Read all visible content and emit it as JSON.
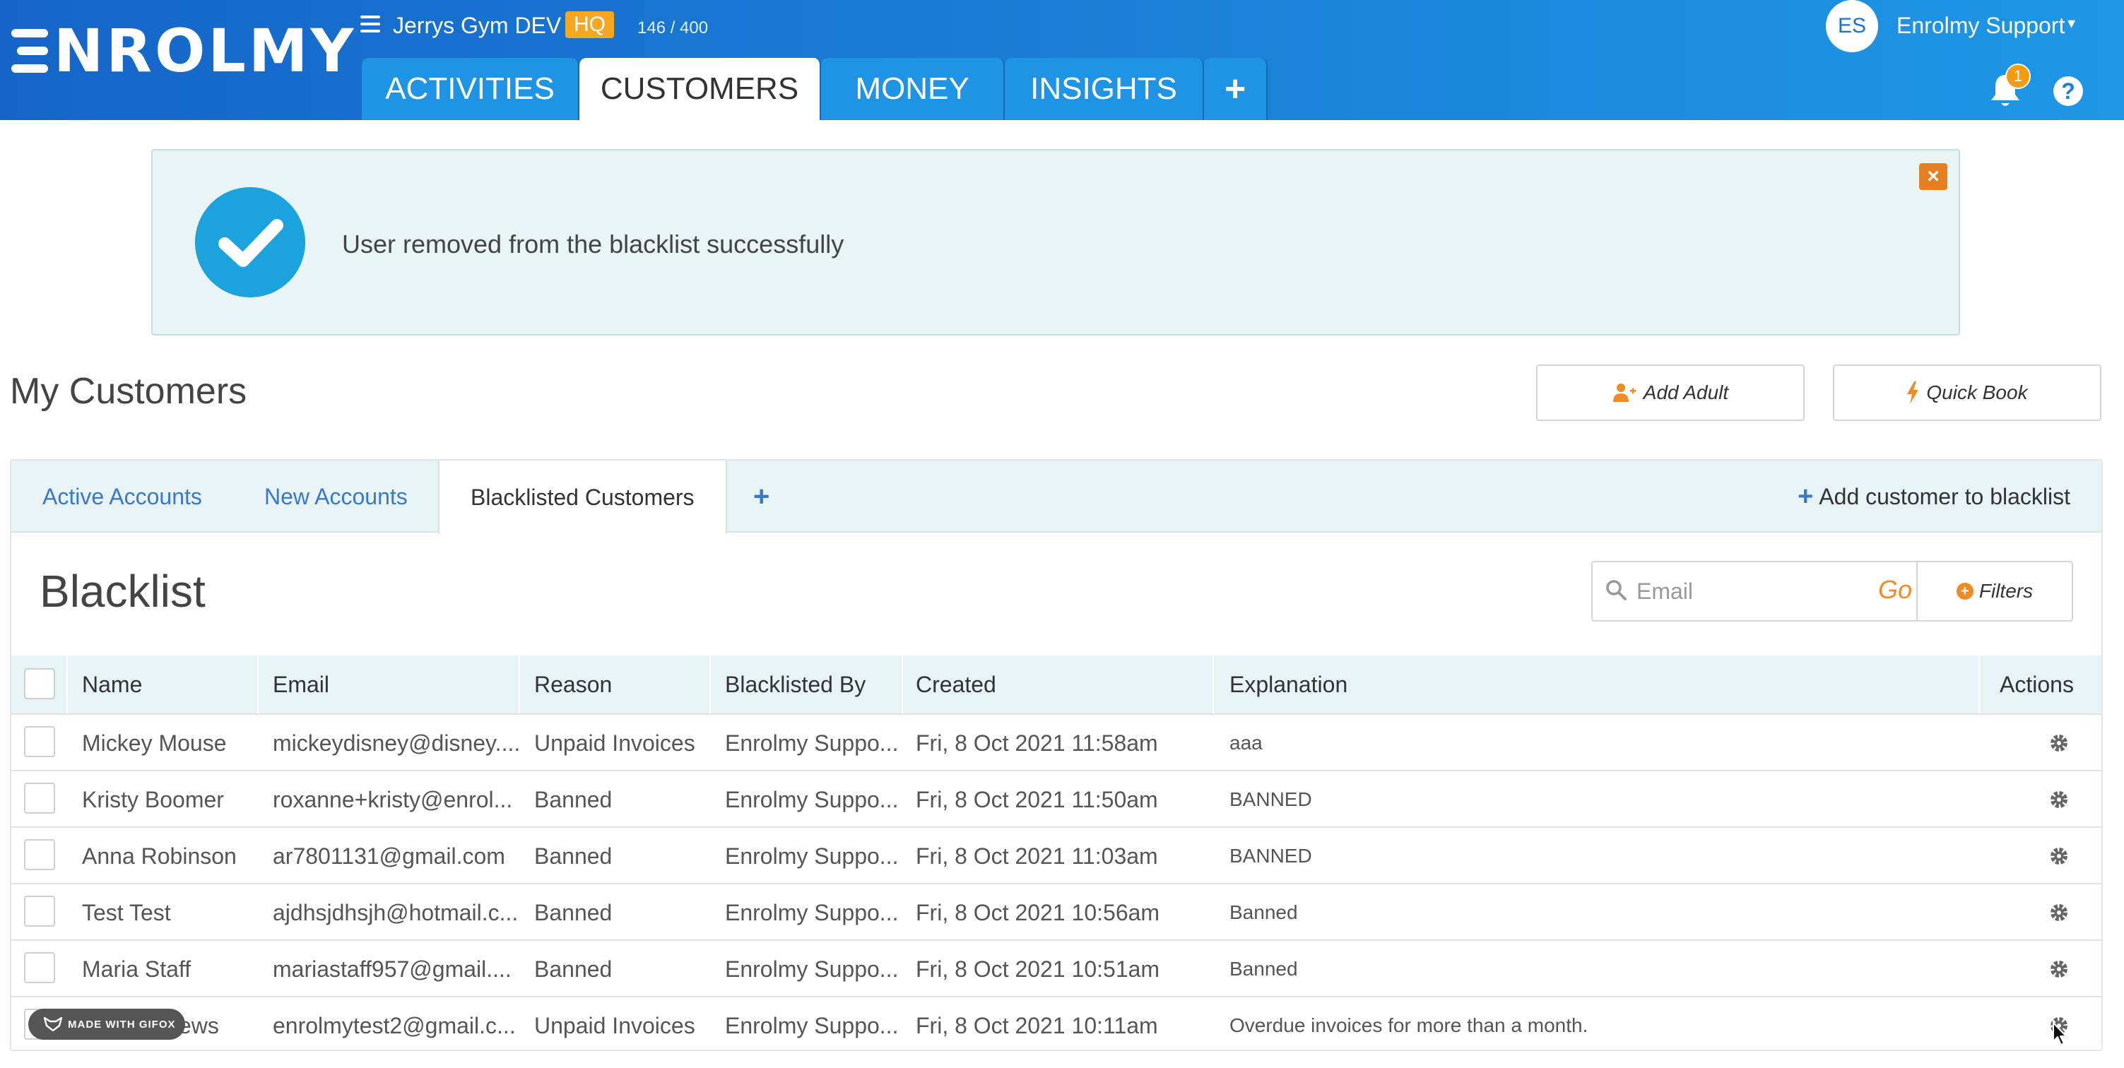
{
  "header": {
    "logo_text": "NROLMY",
    "org_name": "Jerrys Gym DEV",
    "hq_badge": "HQ",
    "counter": "146 / 400",
    "main_tabs": [
      "ACTIVITIES",
      "CUSTOMERS",
      "MONEY",
      "INSIGHTS"
    ],
    "active_tab": "CUSTOMERS",
    "avatar_initials": "ES",
    "user_name": "Enrolmy Support",
    "notification_count": "1",
    "help_label": "?"
  },
  "alert": {
    "message": "User removed from the blacklist successfully",
    "close_label": "×"
  },
  "page": {
    "title": "My Customers",
    "add_adult_label": "Add Adult",
    "quick_book_label": "Quick Book"
  },
  "sub_tabs": {
    "items": [
      "Active Accounts",
      "New Accounts",
      "Blacklisted Customers"
    ],
    "active": "Blacklisted Customers",
    "plus": "+",
    "add_to_blacklist": "Add customer to blacklist"
  },
  "blacklist": {
    "title": "Blacklist",
    "search_placeholder": "Email",
    "go_label": "Go",
    "filters_label": "Filters",
    "columns": [
      "Name",
      "Email",
      "Reason",
      "Blacklisted By",
      "Created",
      "Explanation",
      "Actions"
    ],
    "rows": [
      {
        "name": "Mickey Mouse",
        "email": "mickeydisney@disney....",
        "reason": "Unpaid Invoices",
        "by": "Enrolmy Suppo...",
        "created": "Fri, 8 Oct 2021 11:58am",
        "explanation": "aaa"
      },
      {
        "name": "Kristy Boomer",
        "email": "roxanne+kristy@enrol...",
        "reason": "Banned",
        "by": "Enrolmy Suppo...",
        "created": "Fri, 8 Oct 2021 11:50am",
        "explanation": "BANNED"
      },
      {
        "name": "Anna Robinson",
        "email": "ar7801131@gmail.com",
        "reason": "Banned",
        "by": "Enrolmy Suppo...",
        "created": "Fri, 8 Oct 2021 11:03am",
        "explanation": "BANNED"
      },
      {
        "name": "Test Test",
        "email": "ajdhsjdhsjh@hotmail.c...",
        "reason": "Banned",
        "by": "Enrolmy Suppo...",
        "created": "Fri, 8 Oct 2021 10:56am",
        "explanation": "Banned"
      },
      {
        "name": "Maria Staff",
        "email": "mariastaff957@gmail....",
        "reason": "Banned",
        "by": "Enrolmy Suppo...",
        "created": "Fri, 8 Oct 2021 10:51am",
        "explanation": "Banned"
      },
      {
        "name": "Ann Mathews",
        "email": "enrolmytest2@gmail.c...",
        "reason": "Unpaid Invoices",
        "by": "Enrolmy Suppo...",
        "created": "Fri, 8 Oct 2021 10:11am",
        "explanation": "Overdue invoices for more than a month."
      }
    ]
  },
  "overlay": {
    "gifox_label": "MADE WITH GIFOX"
  },
  "colors": {
    "header_start": "#1565c8",
    "header_end": "#1f96e6",
    "accent_orange": "#f08c24",
    "link_blue": "#3a78c9",
    "alert_bg": "#e9f4f5",
    "check_blue": "#1aa3dd"
  },
  "icons": {
    "menu": "hamburger-icon",
    "bell": "bell-icon",
    "help": "help-icon",
    "check": "check-circle-icon",
    "close": "close-icon",
    "add_user": "user-plus-icon",
    "bolt": "bolt-icon",
    "search": "search-icon",
    "filter": "plus-circle-icon",
    "gear": "gear-icon"
  }
}
